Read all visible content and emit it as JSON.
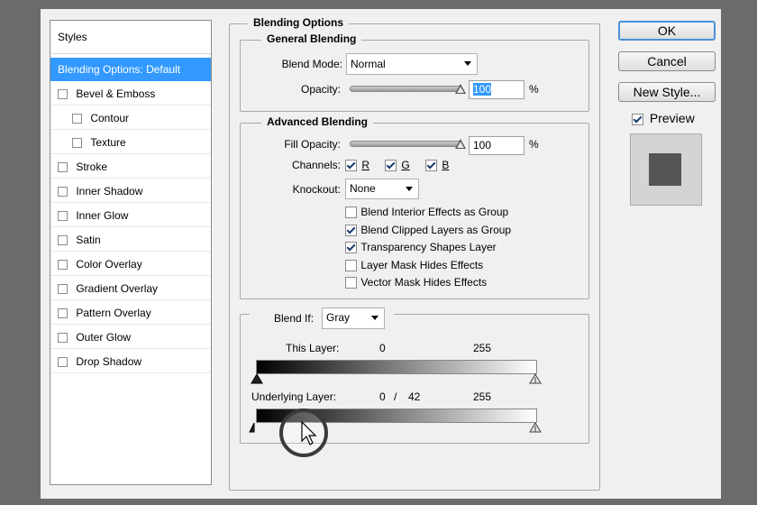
{
  "styles_panel": {
    "header": "Styles",
    "items": [
      {
        "label": "Blending Options: Default",
        "checkbox": false,
        "selected": true
      },
      {
        "label": "Bevel & Emboss",
        "checkbox": true
      },
      {
        "label": "Contour",
        "checkbox": true
      },
      {
        "label": "Texture",
        "checkbox": true
      },
      {
        "label": "Stroke",
        "checkbox": true
      },
      {
        "label": "Inner Shadow",
        "checkbox": true
      },
      {
        "label": "Inner Glow",
        "checkbox": true
      },
      {
        "label": "Satin",
        "checkbox": true
      },
      {
        "label": "Color Overlay",
        "checkbox": true
      },
      {
        "label": "Gradient Overlay",
        "checkbox": true
      },
      {
        "label": "Pattern Overlay",
        "checkbox": true
      },
      {
        "label": "Outer Glow",
        "checkbox": true
      },
      {
        "label": "Drop Shadow",
        "checkbox": true
      }
    ]
  },
  "blending_options": {
    "title": "Blending Options",
    "general": {
      "title": "General Blending",
      "blend_mode_label": "Blend Mode:",
      "blend_mode_value": "Normal",
      "opacity_label": "Opacity:",
      "opacity_value": "100",
      "opacity_unit": "%",
      "opacity_level": 1.0
    },
    "advanced": {
      "title": "Advanced Blending",
      "fill_opacity_label": "Fill Opacity:",
      "fill_opacity_value": "100",
      "fill_opacity_unit": "%",
      "fill_opacity_level": 1.0,
      "channels_label": "Channels:",
      "channel_r": "R",
      "channel_g": "G",
      "channel_b": "B",
      "knockout_label": "Knockout:",
      "knockout_value": "None",
      "options": [
        {
          "label": "Blend Interior Effects as Group",
          "checked": false
        },
        {
          "label": "Blend Clipped Layers as Group",
          "checked": true
        },
        {
          "label": "Transparency Shapes Layer",
          "checked": true
        },
        {
          "label": "Layer Mask Hides Effects",
          "checked": false
        },
        {
          "label": "Vector Mask Hides Effects",
          "checked": false
        }
      ]
    },
    "blend_if": {
      "label": "Blend If:",
      "value": "Gray",
      "this_layer_label": "This Layer:",
      "this_layer_low": "0",
      "this_layer_high": "255",
      "underlying_label": "Underlying Layer:",
      "underlying_low": "0",
      "underlying_sep": "/",
      "underlying_low_split": "42",
      "underlying_high": "255"
    }
  },
  "buttons": {
    "ok": "OK",
    "cancel": "Cancel",
    "new_style": "New Style...",
    "preview_label": "Preview"
  },
  "colors": {
    "selection": "#3399ff",
    "dialog_bg": "#f0f0f0",
    "backdrop": "#6b6b6b",
    "preview_swatch": "#555555"
  }
}
